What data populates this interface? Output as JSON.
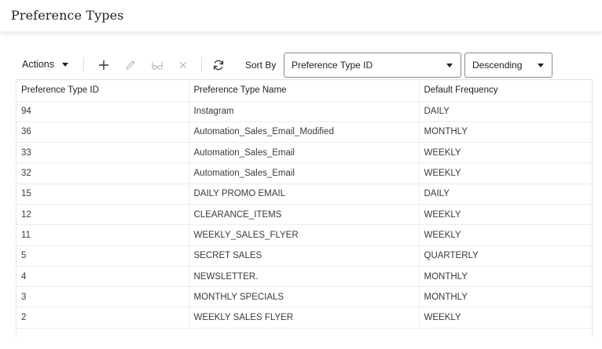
{
  "page": {
    "title": "Preference Types"
  },
  "toolbar": {
    "actions_label": "Actions",
    "icons": [
      "add-icon",
      "edit-icon",
      "view-icon",
      "delete-icon",
      "refresh-icon"
    ],
    "sort_by_label": "Sort By",
    "sort_field": "Preference Type ID",
    "sort_order": "Descending"
  },
  "table": {
    "columns": [
      "Preference Type ID",
      "Preference Type Name",
      "Default Frequency"
    ],
    "rows": [
      [
        "94",
        "Instagram",
        "DAILY"
      ],
      [
        "36",
        "Automation_Sales_Email_Modified",
        "MONTHLY"
      ],
      [
        "33",
        "Automation_Sales_Email",
        "WEEKLY"
      ],
      [
        "32",
        "Automation_Sales_Email",
        "WEEKLY"
      ],
      [
        "15",
        "DAILY PROMO EMAIL",
        "DAILY"
      ],
      [
        "12",
        "CLEARANCE_ITEMS",
        "WEEKLY"
      ],
      [
        "11",
        "WEEKLY_SALES_FLYER",
        "WEEKLY"
      ],
      [
        "5",
        "SECRET SALES",
        "QUARTERLY"
      ],
      [
        "4",
        "NEWSLETTER.",
        "MONTHLY"
      ],
      [
        "3",
        "MONTHLY SPECIALS",
        "MONTHLY"
      ],
      [
        "2",
        "WEEKLY SALES FLYER",
        "WEEKLY"
      ]
    ]
  }
}
